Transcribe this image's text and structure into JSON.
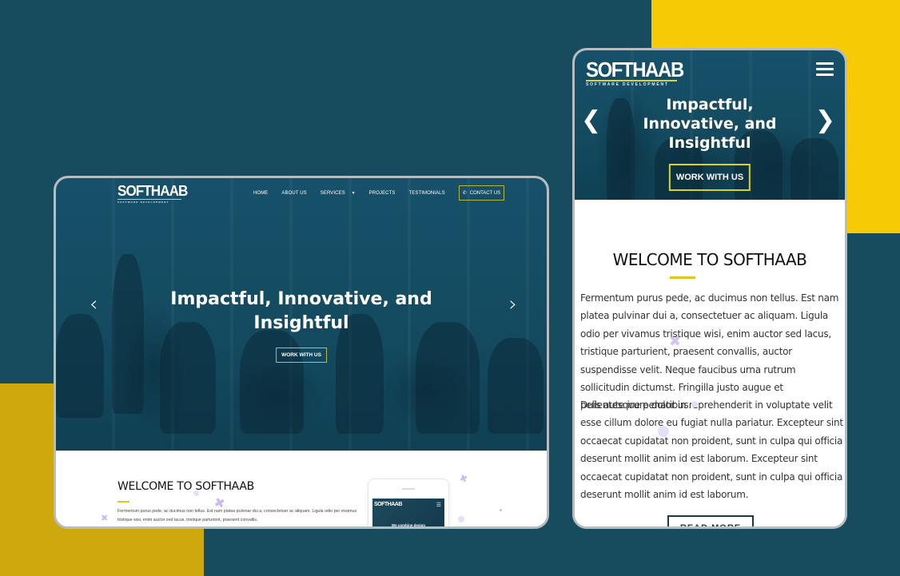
{
  "colors": {
    "background": "#164c5e",
    "accent_yellow": "#f6cb06",
    "accent_yellow_dark": "#cda90e",
    "hero_overlay": "#134a5f",
    "button_border": "#c2c12f",
    "decor_purple": "#c9b9f4"
  },
  "desktop": {
    "logo": {
      "name": "SOFTHAAB",
      "tagline": "SOFTWARE DEVELOPMENT"
    },
    "nav": {
      "items": [
        {
          "label": "HOME"
        },
        {
          "label": "ABOUT US"
        },
        {
          "label": "SERVICES",
          "has_dropdown": true,
          "icon": "caret-down-icon"
        },
        {
          "label": "PROJECTS"
        },
        {
          "label": "TESTIMONIALS"
        }
      ],
      "contact": {
        "label": "CONTACT US",
        "icon": "phone-icon"
      }
    },
    "hero": {
      "title": "Impactful, Innovative, and Insightful",
      "cta_label": "WORK WITH US",
      "prev_icon": "chevron-left-icon",
      "next_icon": "chevron-right-icon"
    },
    "welcome": {
      "heading": "WELCOME TO SOFTHAAB",
      "paragraph": "Fermentum purus pede, ac ducimus non tellus. Est nam platea pulvinar dui a, consectetuer ac aliquam. Ligula odio per vivamus tristique wisi, enim auctor sed lacus, tristique parturient, praesent convallis."
    },
    "mini_phone": {
      "logo": "SOFTHAAB",
      "menu_icon": "hamburger-icon",
      "caption": "We combine design"
    }
  },
  "mobile": {
    "logo": {
      "name": "SOFTHAAB",
      "tagline": "SOFTWARE DEVELOPMENT"
    },
    "menu_icon": "hamburger-icon",
    "hero": {
      "title": "Impactful, Innovative, and Insightful",
      "cta_label": "WORK WITH US",
      "prev_icon": "chevron-left-icon",
      "next_icon": "chevron-right-icon"
    },
    "welcome": {
      "heading": "WELCOME TO SOFTHAAB",
      "paragraph1": "Fermentum purus pede, ac ducimus non tellus. Est nam platea pulvinar dui a, consectetuer ac aliquam. Ligula odio per vivamus tristique wisi, enim auctor sed lacus, tristique parturient, praesent convallis, auctor suspendisse velit. Neque faucibus urna rutrum sollicitudin dictumst. Fringilla justo augue et pellentesque penatibus.",
      "paragraph2": "Duis aute irure dolor in reprehenderit in voluptate velit esse cillum dolore eu fugiat nulla pariatur. Excepteur sint occaecat cupidatat non proident, sunt in culpa qui officia deserunt mollit anim id est laborum. Excepteur sint occaecat cupidatat non proident, sunt in culpa qui officia deserunt mollit anim id est laborum.",
      "read_more_label": "READ MORE"
    }
  }
}
